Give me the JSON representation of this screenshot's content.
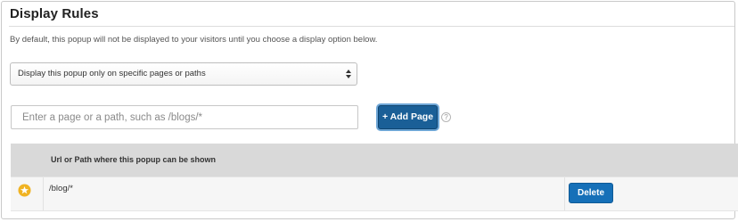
{
  "section": {
    "title": "Display Rules",
    "description": "By default, this popup will not be displayed to your visitors until you choose a display option below."
  },
  "display_select": {
    "selected": "Display this popup only on specific pages or paths",
    "icon": "select-arrows-icon"
  },
  "path_input": {
    "placeholder": "Enter a page or a path, such as /blogs/*",
    "value": ""
  },
  "add_button": {
    "label": "+ Add Page",
    "color": "#1a5f97"
  },
  "help": {
    "icon": "question-circle-icon",
    "glyph": "?"
  },
  "table": {
    "header": {
      "icon_col": "",
      "url_col": "Url or Path where this popup can be shown",
      "action_col": ""
    },
    "rows": [
      {
        "icon": "star-icon",
        "path": "/blog/*",
        "action_label": "Delete"
      }
    ]
  },
  "colors": {
    "header_bg": "#d9d9d9",
    "row_bg": "#f6f6f6",
    "star": "#f0b323",
    "delete_button": "#1670b8"
  }
}
